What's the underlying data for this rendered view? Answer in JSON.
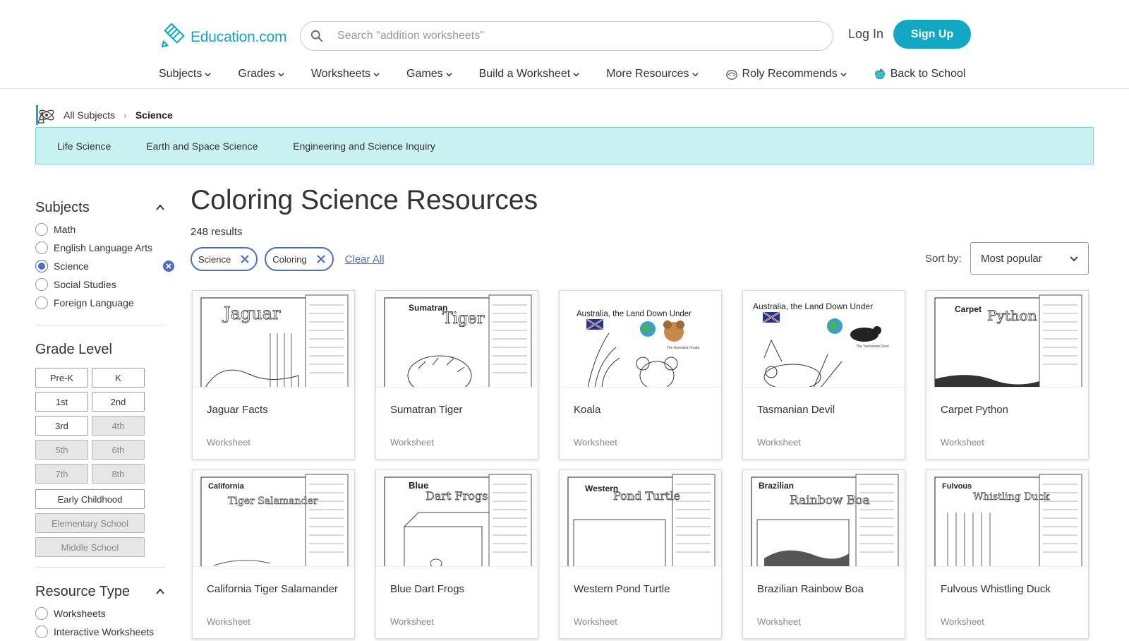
{
  "brand": {
    "name": "Education.com",
    "color": "#12a8c4"
  },
  "search": {
    "placeholder": "Search \"addition worksheets\"",
    "value": ""
  },
  "auth": {
    "login": "Log In",
    "signup": "Sign Up"
  },
  "nav": {
    "items": [
      {
        "label": "Subjects",
        "icon": "chevron-down-icon"
      },
      {
        "label": "Grades",
        "icon": "chevron-down-icon"
      },
      {
        "label": "Worksheets",
        "icon": "chevron-down-icon"
      },
      {
        "label": "Games",
        "icon": "chevron-down-icon"
      },
      {
        "label": "Build a Worksheet",
        "icon": "chevron-down-icon"
      },
      {
        "label": "More Resources",
        "icon": "chevron-down-icon"
      },
      {
        "label": "Roly Recommends",
        "icon": "roly-icon"
      },
      {
        "label": "Back to School",
        "icon": "apple-icon"
      }
    ]
  },
  "breadcrumb": {
    "root": "All Subjects",
    "current": "Science"
  },
  "subject_tabs": [
    "Life Science",
    "Earth and Space Science",
    "Engineering and Science Inquiry"
  ],
  "sidebar": {
    "subjects_title": "Subjects",
    "subjects": [
      {
        "label": "Math",
        "checked": false
      },
      {
        "label": "English Language Arts",
        "checked": false
      },
      {
        "label": "Science",
        "checked": true
      },
      {
        "label": "Social Studies",
        "checked": false
      },
      {
        "label": "Foreign Language",
        "checked": false
      }
    ],
    "grade_title": "Grade Level",
    "grades": [
      {
        "label": "Pre-K",
        "disabled": false
      },
      {
        "label": "K",
        "disabled": false
      },
      {
        "label": "1st",
        "disabled": false
      },
      {
        "label": "2nd",
        "disabled": false
      },
      {
        "label": "3rd",
        "disabled": false
      },
      {
        "label": "4th",
        "disabled": true
      },
      {
        "label": "5th",
        "disabled": true
      },
      {
        "label": "6th",
        "disabled": true
      },
      {
        "label": "7th",
        "disabled": true
      },
      {
        "label": "8th",
        "disabled": true
      }
    ],
    "grade_groups": [
      {
        "label": "Early Childhood",
        "disabled": false
      },
      {
        "label": "Elementary School",
        "disabled": true
      },
      {
        "label": "Middle School",
        "disabled": true
      }
    ],
    "resource_title": "Resource Type",
    "resource_types": [
      {
        "label": "Worksheets",
        "checked": false
      },
      {
        "label": "Interactive Worksheets",
        "checked": false
      }
    ]
  },
  "main": {
    "title": "Coloring Science Resources",
    "results": "248 results",
    "filters": [
      "Science",
      "Coloring"
    ],
    "clear_all": "Clear All",
    "sort_label": "Sort by:",
    "sort_value": "Most popular"
  },
  "cards": [
    {
      "title": "Jaguar Facts",
      "type": "Worksheet",
      "thumb_top": "",
      "thumb_big": "Jaguar"
    },
    {
      "title": "Sumatran Tiger",
      "type": "Worksheet",
      "thumb_top": "Sumatran",
      "thumb_big": "Tiger"
    },
    {
      "title": "Koala",
      "type": "Worksheet",
      "thumb_top": "Australia, the Land Down Under",
      "thumb_big": "The Australian Koala"
    },
    {
      "title": "Tasmanian Devil",
      "type": "Worksheet",
      "thumb_top": "Australia, the Land Down Under",
      "thumb_big": "The Tasmanian Devil"
    },
    {
      "title": "Carpet Python",
      "type": "Worksheet",
      "thumb_top": "Carpet",
      "thumb_big": "Python"
    },
    {
      "title": "California Tiger Salamander",
      "type": "Worksheet",
      "thumb_top": "California",
      "thumb_big": "Tiger Salamander"
    },
    {
      "title": "Blue Dart Frogs",
      "type": "Worksheet",
      "thumb_top": "Blue",
      "thumb_big": "Dart Frogs"
    },
    {
      "title": "Western Pond Turtle",
      "type": "Worksheet",
      "thumb_top": "Western",
      "thumb_big": "Pond Turtle"
    },
    {
      "title": "Brazilian Rainbow Boa",
      "type": "Worksheet",
      "thumb_top": "Brazilian",
      "thumb_big": "Rainbow Boa"
    },
    {
      "title": "Fulvous Whistling Duck",
      "type": "Worksheet",
      "thumb_top": "Fulvous",
      "thumb_big": "Whistling Duck"
    }
  ]
}
